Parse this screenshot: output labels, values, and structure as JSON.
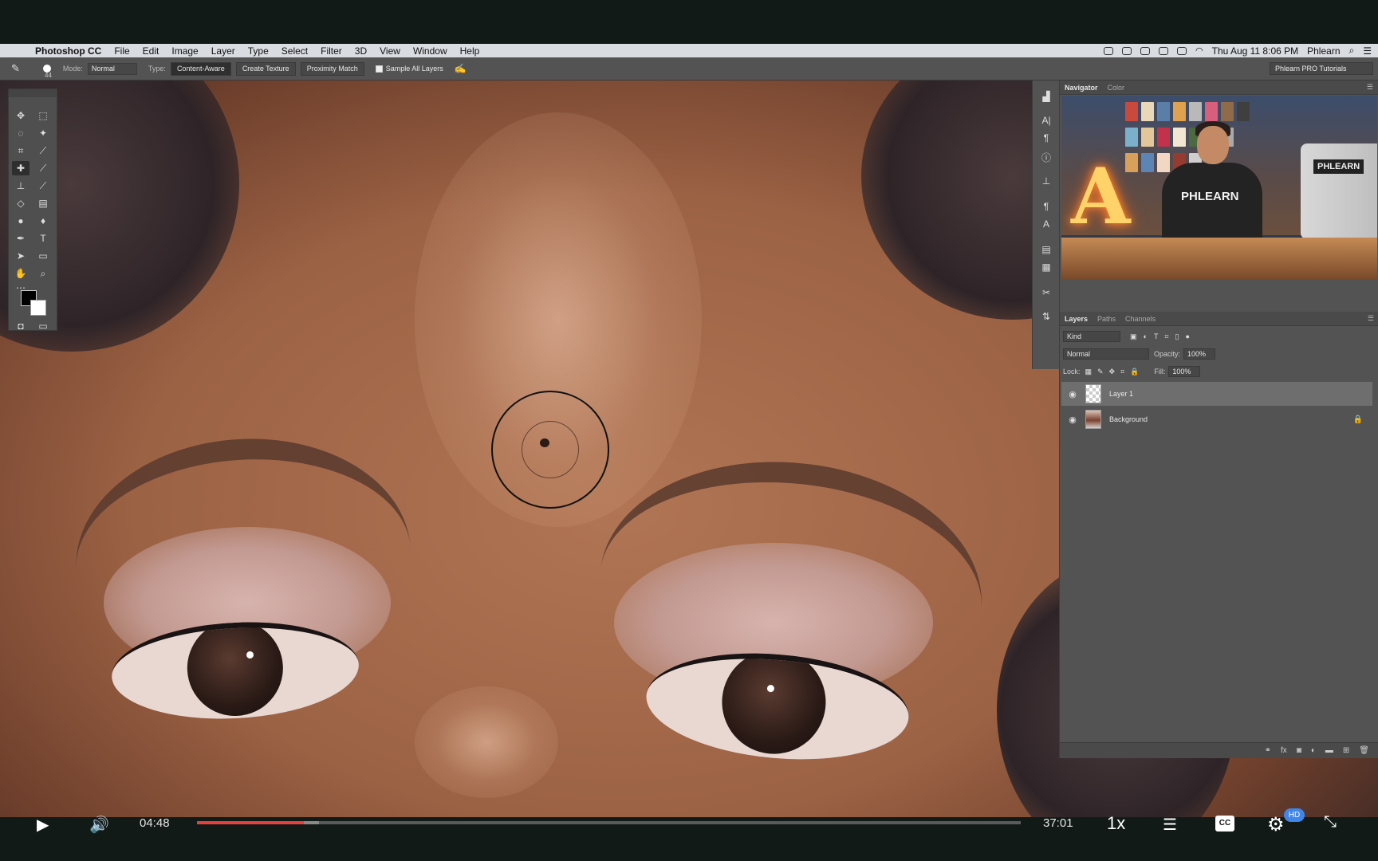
{
  "menubar": {
    "app_name": "Photoshop CC",
    "menus": [
      "File",
      "Edit",
      "Image",
      "Layer",
      "Type",
      "Select",
      "Filter",
      "3D",
      "View",
      "Window",
      "Help"
    ],
    "datetime": "Thu Aug 11  8:06 PM",
    "user": "Phlearn"
  },
  "options": {
    "brush_size": "44",
    "mode_label": "Mode:",
    "mode_value": "Normal",
    "type_label": "Type:",
    "type_options": [
      "Content-Aware",
      "Create Texture",
      "Proximity Match"
    ],
    "sample_all_layers": "Sample All Layers",
    "workspace": "Phlearn PRO Tutorials"
  },
  "navigator": {
    "tabs": [
      "Navigator",
      "Color"
    ],
    "shirt_text": "PHLEARN",
    "monitor_logo": "PHLEARN",
    "sign_letter": "A"
  },
  "layers": {
    "tabs": [
      "Layers",
      "Paths",
      "Channels"
    ],
    "filter_kind": "Kind",
    "blend_mode": "Normal",
    "opacity_label": "Opacity:",
    "opacity_value": "100%",
    "lock_label": "Lock:",
    "fill_label": "Fill:",
    "fill_value": "100%",
    "items": [
      {
        "name": "Layer 1",
        "selected": true,
        "locked": false
      },
      {
        "name": "Background",
        "selected": false,
        "locked": true
      }
    ]
  },
  "player": {
    "time_current": "04:48",
    "time_total": "37:01",
    "speed": "1x",
    "cc_label": "CC",
    "hd_label": "HD",
    "progress": 0.13,
    "buffered": 0.148,
    "colors": {
      "progress": "#e4413f",
      "hd_badge": "#3f86e8"
    }
  }
}
